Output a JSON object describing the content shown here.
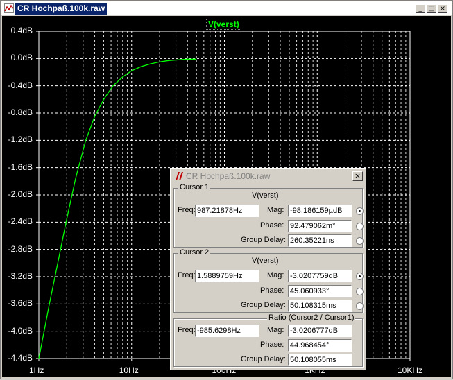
{
  "window": {
    "title": "CR Hochpaß.100k.raw"
  },
  "plot": {
    "trace_label": "V(verst)",
    "y_ticks": [
      "0.4dB",
      "0.0dB",
      "-0.4dB",
      "-0.8dB",
      "-1.2dB",
      "-1.6dB",
      "-2.0dB",
      "-2.4dB",
      "-2.8dB",
      "-3.2dB",
      "-3.6dB",
      "-4.0dB",
      "-4.4dB"
    ],
    "x_ticks": [
      "1Hz",
      "10Hz",
      "100Hz",
      "1KHz",
      "10KHz"
    ],
    "colors": {
      "background": "#000000",
      "grid": "#ffffff",
      "trace": "#00ff00"
    }
  },
  "chart_data": {
    "type": "line",
    "title": "",
    "xlabel": "",
    "ylabel": "",
    "x_scale": "log",
    "xlim": [
      1,
      10000
    ],
    "ylim": [
      -4.4,
      0.4
    ],
    "series": [
      {
        "name": "V(verst)",
        "x": [
          1.0,
          1.3,
          1.6,
          2.0,
          2.5,
          3.2,
          4.0,
          5.0,
          6.3,
          8.0,
          10.0,
          12.6,
          15.8,
          20.0,
          25.0,
          31.6,
          40.0,
          50.0
        ],
        "y": [
          -4.4,
          -3.6,
          -3.0,
          -2.35,
          -1.75,
          -1.2,
          -0.85,
          -0.6,
          -0.4,
          -0.27,
          -0.18,
          -0.12,
          -0.08,
          -0.05,
          -0.03,
          -0.02,
          -0.01,
          -0.01
        ]
      }
    ]
  },
  "dialog": {
    "title": "CR Hochpaß.100k.raw",
    "cursor1": {
      "group_label": "Cursor 1",
      "trace": "V(verst)",
      "freq_label": "Freq:",
      "freq": "987.21878Hz",
      "mag_label": "Mag:",
      "mag": "-98.186159µdB",
      "phase_label": "Phase:",
      "phase": "92.479062m°",
      "gd_label": "Group Delay:",
      "group_delay": "260.35221ns",
      "selected": "mag"
    },
    "cursor2": {
      "group_label": "Cursor 2",
      "trace": "V(verst)",
      "freq_label": "Freq:",
      "freq": "1.5889759Hz",
      "mag_label": "Mag:",
      "mag": "-3.0207759dB",
      "phase_label": "Phase:",
      "phase": "45.060933°",
      "gd_label": "Group Delay:",
      "group_delay": "50.108315ms",
      "selected": "mag"
    },
    "ratio": {
      "group_label": "Ratio (Cursor2 / Cursor1)",
      "freq_label": "Freq:",
      "freq": "-985.6298Hz",
      "mag_label": "Mag:",
      "mag": "-3.0206777dB",
      "phase_label": "Phase:",
      "phase": "44.968454°",
      "gd_label": "Group Delay:",
      "group_delay": "50.108055ms"
    }
  }
}
